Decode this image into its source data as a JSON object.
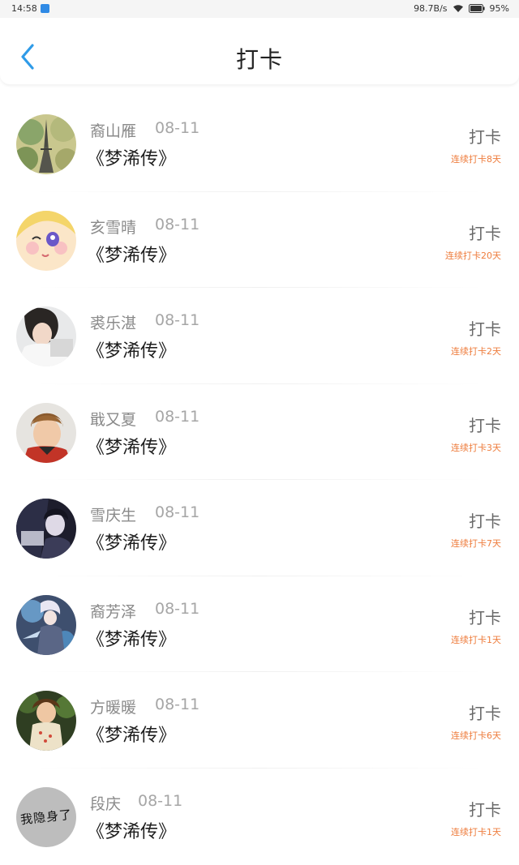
{
  "status_bar": {
    "time": "14:58",
    "network_speed": "98.7B/s",
    "battery": "95%"
  },
  "header": {
    "title": "打卡",
    "back_icon": "chevron-left-icon",
    "accent_color": "#2f9be8"
  },
  "entries": [
    {
      "name": "裔山雁",
      "date": "08-11",
      "book": "《梦浠传》",
      "action": "打卡",
      "streak": "连续打卡8天",
      "avatar": "eiffel-tower-photo"
    },
    {
      "name": "亥雪晴",
      "date": "08-11",
      "book": "《梦浠传》",
      "action": "打卡",
      "streak": "连续打卡20天",
      "avatar": "cartoon-girl-face"
    },
    {
      "name": "裘乐湛",
      "date": "08-11",
      "book": "《梦浠传》",
      "action": "打卡",
      "streak": "连续打卡2天",
      "avatar": "girl-portrait-photo"
    },
    {
      "name": "戢又夏",
      "date": "08-11",
      "book": "《梦浠传》",
      "action": "打卡",
      "streak": "连续打卡3天",
      "avatar": "boy-portrait-photo"
    },
    {
      "name": "雪庆生",
      "date": "08-11",
      "book": "《梦浠传》",
      "action": "打卡",
      "streak": "连续打卡7天",
      "avatar": "dark-anime-photo"
    },
    {
      "name": "裔芳泽",
      "date": "08-11",
      "book": "《梦浠传》",
      "action": "打卡",
      "streak": "连续打卡1天",
      "avatar": "game-character-art"
    },
    {
      "name": "方暖暖",
      "date": "08-11",
      "book": "《梦浠传》",
      "action": "打卡",
      "streak": "连续打卡6天",
      "avatar": "child-photo"
    },
    {
      "name": "段庆",
      "date": "08-11",
      "book": "《梦浠传》",
      "action": "打卡",
      "streak": "连续打卡1天",
      "avatar": "hidden-avatar",
      "avatar_text": "我隐身了"
    }
  ],
  "colors": {
    "streak": "#ee7c3c",
    "name": "#8a8a8a",
    "book": "#1e1e1e"
  }
}
